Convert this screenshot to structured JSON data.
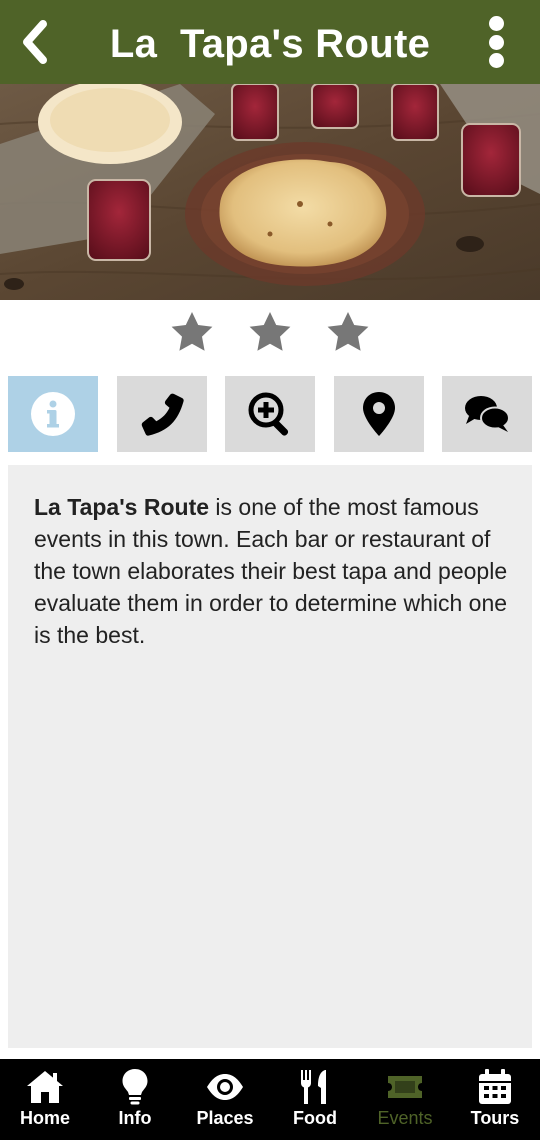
{
  "header": {
    "title": "La  Tapa's Route",
    "back_icon": "chevron-left-icon",
    "menu_icon": "ellipsis-vertical-icon",
    "bg_color": "#4f6328"
  },
  "hero": {
    "alt": "Tapa dish with glasses of wine on a wooden table"
  },
  "rating": {
    "value": 3,
    "max": 3
  },
  "tabs": [
    {
      "icon": "info-icon",
      "active": true
    },
    {
      "icon": "phone-icon",
      "active": false
    },
    {
      "icon": "zoom-in-icon",
      "active": false
    },
    {
      "icon": "location-pin-icon",
      "active": false
    },
    {
      "icon": "comments-icon",
      "active": false
    }
  ],
  "description": {
    "bold_lead": "La Tapa's Route",
    "text": " is one of the most famous events in this town. Each bar or restaurant of the town elaborates their best tapa and people evaluate them in order to determine which one is the best."
  },
  "bottom_nav": {
    "items": [
      {
        "label": "Home",
        "icon": "home-icon"
      },
      {
        "label": "Info",
        "icon": "lightbulb-icon"
      },
      {
        "label": "Places",
        "icon": "eye-icon"
      },
      {
        "label": "Food",
        "icon": "utensils-icon"
      },
      {
        "label": "Events",
        "icon": "ticket-icon",
        "current": true
      },
      {
        "label": "Tours",
        "icon": "calendar-icon"
      }
    ],
    "active_color": "#4f6328"
  }
}
